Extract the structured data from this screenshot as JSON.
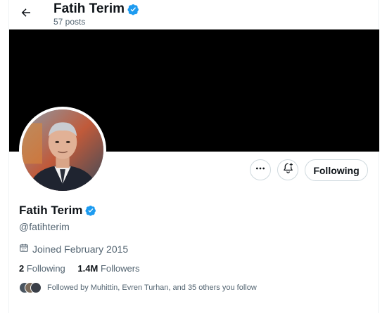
{
  "header": {
    "name": "Fatih Terim",
    "posts_count": "57 posts"
  },
  "profile": {
    "display_name": "Fatih Terim",
    "handle": "@fatihterim",
    "joined": "Joined February 2015",
    "following_count": "2",
    "following_label": "Following",
    "followers_count": "1.4M",
    "followers_label": "Followers",
    "followed_by": "Followed by Muhittin, Evren Turhan, and 35 others you follow"
  },
  "actions": {
    "follow_state": "Following"
  },
  "icons": {
    "back": "arrow-left-icon",
    "verified": "verified-badge-icon",
    "more": "more-dots-icon",
    "notify": "bell-plus-icon",
    "calendar": "calendar-icon"
  },
  "colors": {
    "verified": "#1d9bf0",
    "banner": "#000000",
    "secondary_text": "#536471"
  }
}
